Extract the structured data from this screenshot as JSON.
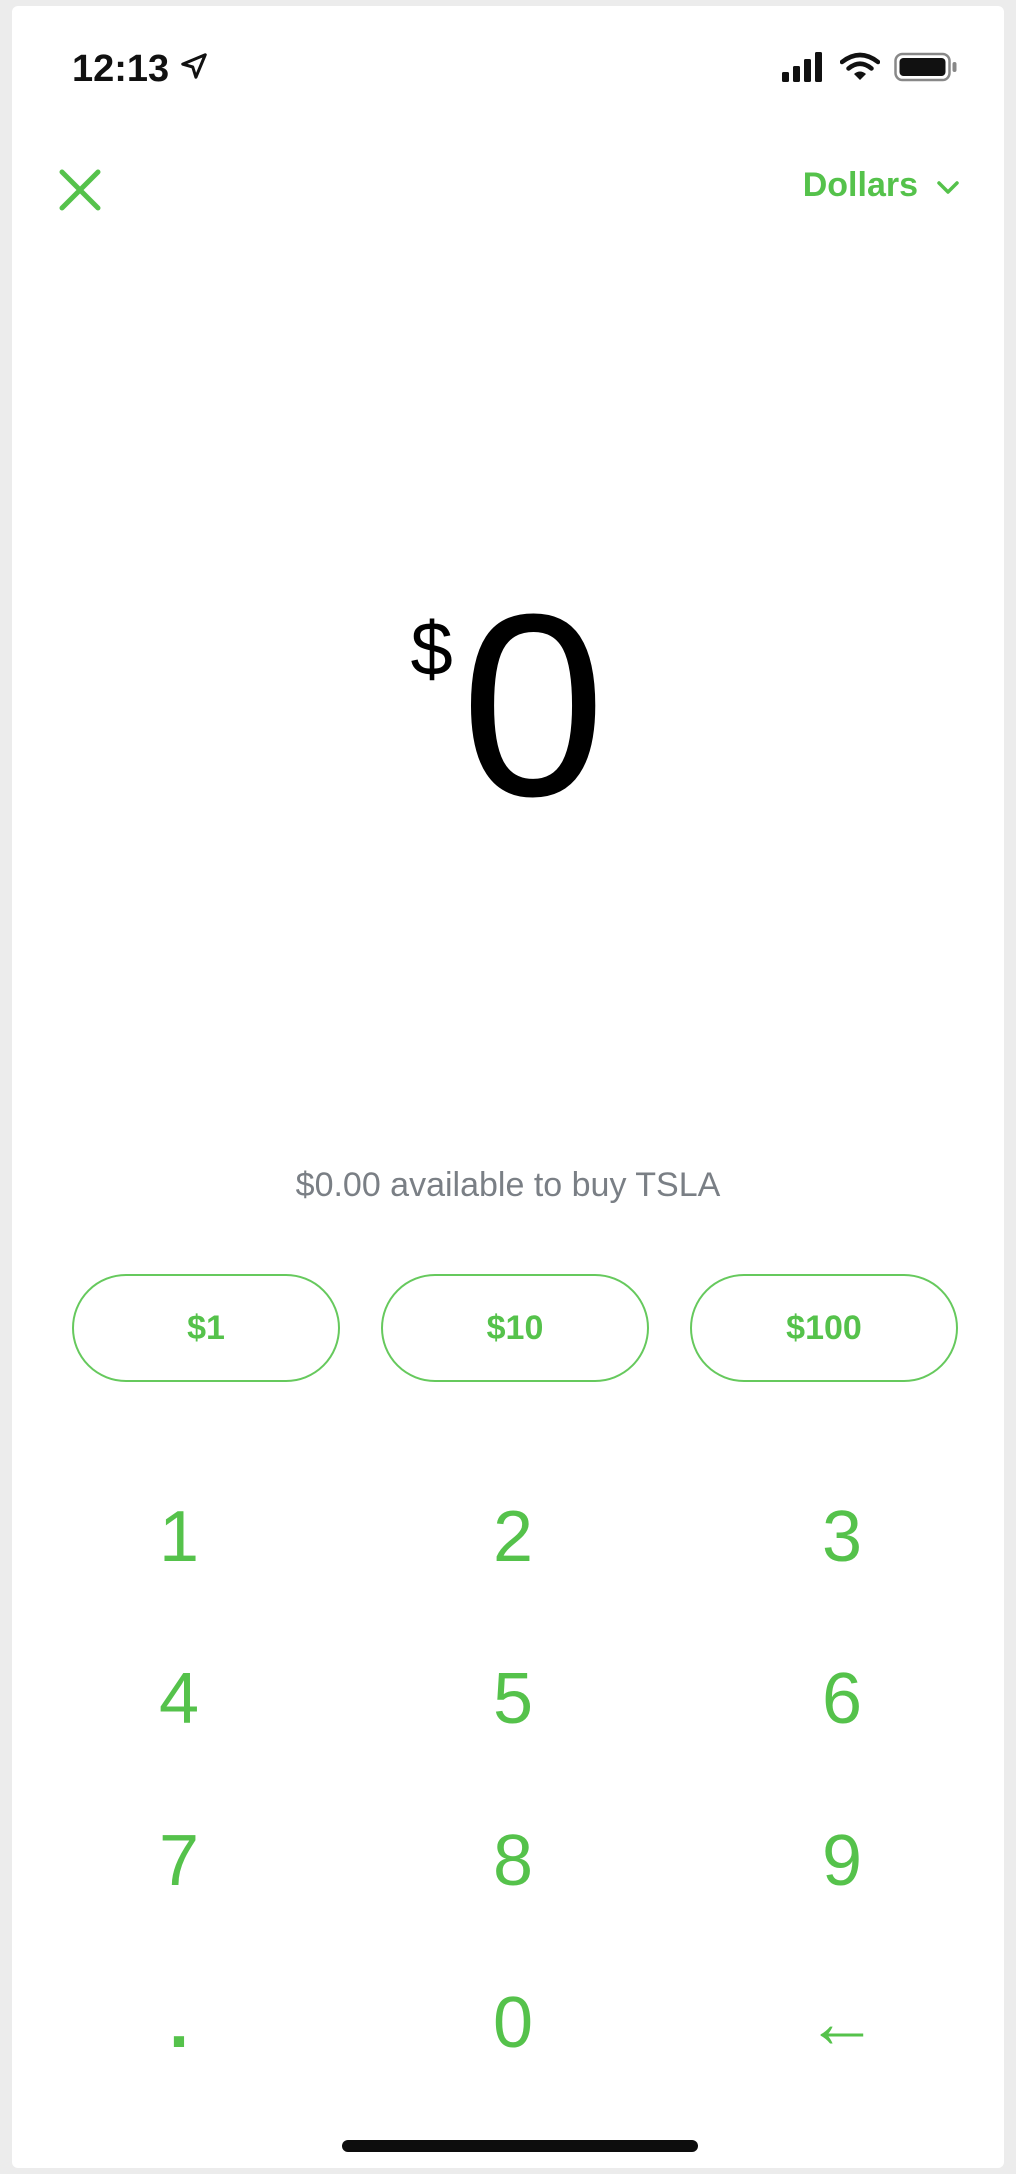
{
  "status_bar": {
    "time": "12:13",
    "icons": [
      "location-arrow-icon",
      "cellular-signal-icon",
      "wifi-icon",
      "battery-icon"
    ]
  },
  "header": {
    "close_icon": "close-icon",
    "currency_label": "Dollars",
    "currency_icon": "chevron-down-icon"
  },
  "amount": {
    "symbol": "$",
    "value": "0"
  },
  "availability_text": "$0.00 available to buy TSLA",
  "presets": [
    {
      "label": "$1"
    },
    {
      "label": "$10"
    },
    {
      "label": "$100"
    }
  ],
  "keypad": {
    "keys": [
      "1",
      "2",
      "3",
      "4",
      "5",
      "6",
      "7",
      "8",
      "9",
      ".",
      "0",
      "←"
    ]
  },
  "colors": {
    "accent": "#55c24b",
    "text_primary": "#000000",
    "text_secondary": "#7a7f85",
    "background": "#ffffff"
  }
}
